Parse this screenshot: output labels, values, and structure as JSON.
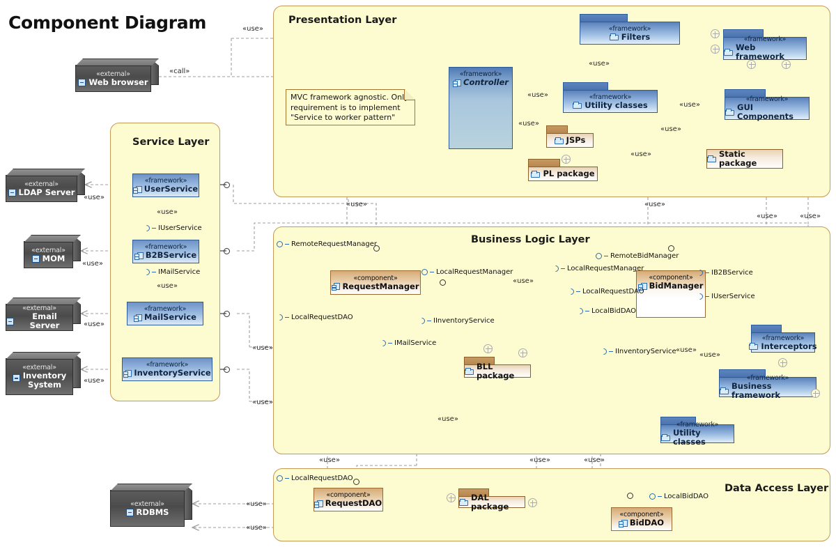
{
  "title": "Component Diagram",
  "colors": {
    "layer_fill": "#fdfbd0",
    "layer_border": "#c49a54",
    "framework_blue": "#5b82bb",
    "component_brown": "#d6ab78",
    "external_grey": "#5d5d5d",
    "interface_blue": "#2a6bb0"
  },
  "stereotypes": {
    "external": "«external»",
    "framework": "«framework»",
    "component": "«component»",
    "use": "«use»",
    "call": "«call»"
  },
  "layers": [
    {
      "id": "presentation",
      "title": "Presentation Layer"
    },
    {
      "id": "service",
      "title": "Service Layer"
    },
    {
      "id": "business",
      "title": "Business Logic Layer"
    },
    {
      "id": "data",
      "title": "Data Access Layer"
    }
  ],
  "external_nodes": [
    {
      "id": "web-browser",
      "stereotype": "«external»",
      "name": "Web browser"
    },
    {
      "id": "ldap-server",
      "stereotype": "«external»",
      "name": "LDAP Server"
    },
    {
      "id": "mom",
      "stereotype": "«external»",
      "name": "MOM"
    },
    {
      "id": "email-server",
      "stereotype": "«external»",
      "name": "Email Server"
    },
    {
      "id": "inventory-system",
      "stereotype": "«external»",
      "name": "Inventory System",
      "name_line1": "Inventory",
      "name_line2": "System"
    },
    {
      "id": "rdbms",
      "stereotype": "«external»",
      "name": "RDBMS"
    }
  ],
  "presentation": {
    "controller": {
      "stereotype": "«framework»",
      "name": "Controller"
    },
    "filters": {
      "stereotype": "«framework»",
      "name": "Filters"
    },
    "web_framework": {
      "stereotype": "«framework»",
      "name": "Web framework"
    },
    "utility_classes": {
      "stereotype": "«framework»",
      "name": "Utility classes"
    },
    "gui_components": {
      "stereotype": "«framework»",
      "name": "GUI Components"
    },
    "jsps": {
      "name": "JSPs"
    },
    "pl_package": {
      "name": "PL package"
    },
    "static_package": {
      "name": "Static package"
    },
    "note": "MVC framework agnostic. Only requirement is to implement \"Service to worker pattern\""
  },
  "service": {
    "components": [
      {
        "id": "user-service",
        "stereotype": "«framework»",
        "name": "UserService"
      },
      {
        "id": "b2b-service",
        "stereotype": "«framework»",
        "name": "B2BService"
      },
      {
        "id": "mail-service",
        "stereotype": "«framework»",
        "name": "MailService"
      },
      {
        "id": "inventory-service",
        "stereotype": "«framework»",
        "name": "InventoryService"
      }
    ],
    "interfaces": [
      {
        "id": "iuserservice",
        "name": "IUserService"
      },
      {
        "id": "imailservice",
        "name": "IMailService"
      }
    ]
  },
  "business": {
    "request_manager": {
      "stereotype": "«component»",
      "name": "RequestManager"
    },
    "bid_manager": {
      "stereotype": "«component»",
      "name": "BidManager"
    },
    "bll_package": {
      "name": "BLL package"
    },
    "interceptors": {
      "stereotype": "«framework»",
      "name": "Interceptors"
    },
    "business_framework": {
      "stereotype": "«framework»",
      "name": "Business framework"
    },
    "utility_classes": {
      "stereotype": "«framework»",
      "name": "Utility classes"
    },
    "interfaces": {
      "remote_request_manager": "RemoteRequestManager",
      "local_request_manager": "LocalRequestManager",
      "local_request_dao": "LocalRequestDAO",
      "imailservice": "IMailService",
      "iinventoryservice": "IInventoryService",
      "remote_bid_manager": "RemoteBidManager",
      "local_bid_dao": "LocalBidDAO",
      "ib2bservice": "IB2BService",
      "iuserservice": "IUserService"
    }
  },
  "data": {
    "request_dao": {
      "stereotype": "«component»",
      "name": "RequestDAO"
    },
    "bid_dao": {
      "stereotype": "«component»",
      "name": "BidDAO"
    },
    "dal_package": {
      "name": "DAL package"
    },
    "interfaces": {
      "local_request_dao": "LocalRequestDAO",
      "local_bid_dao": "LocalBidDAO"
    }
  }
}
